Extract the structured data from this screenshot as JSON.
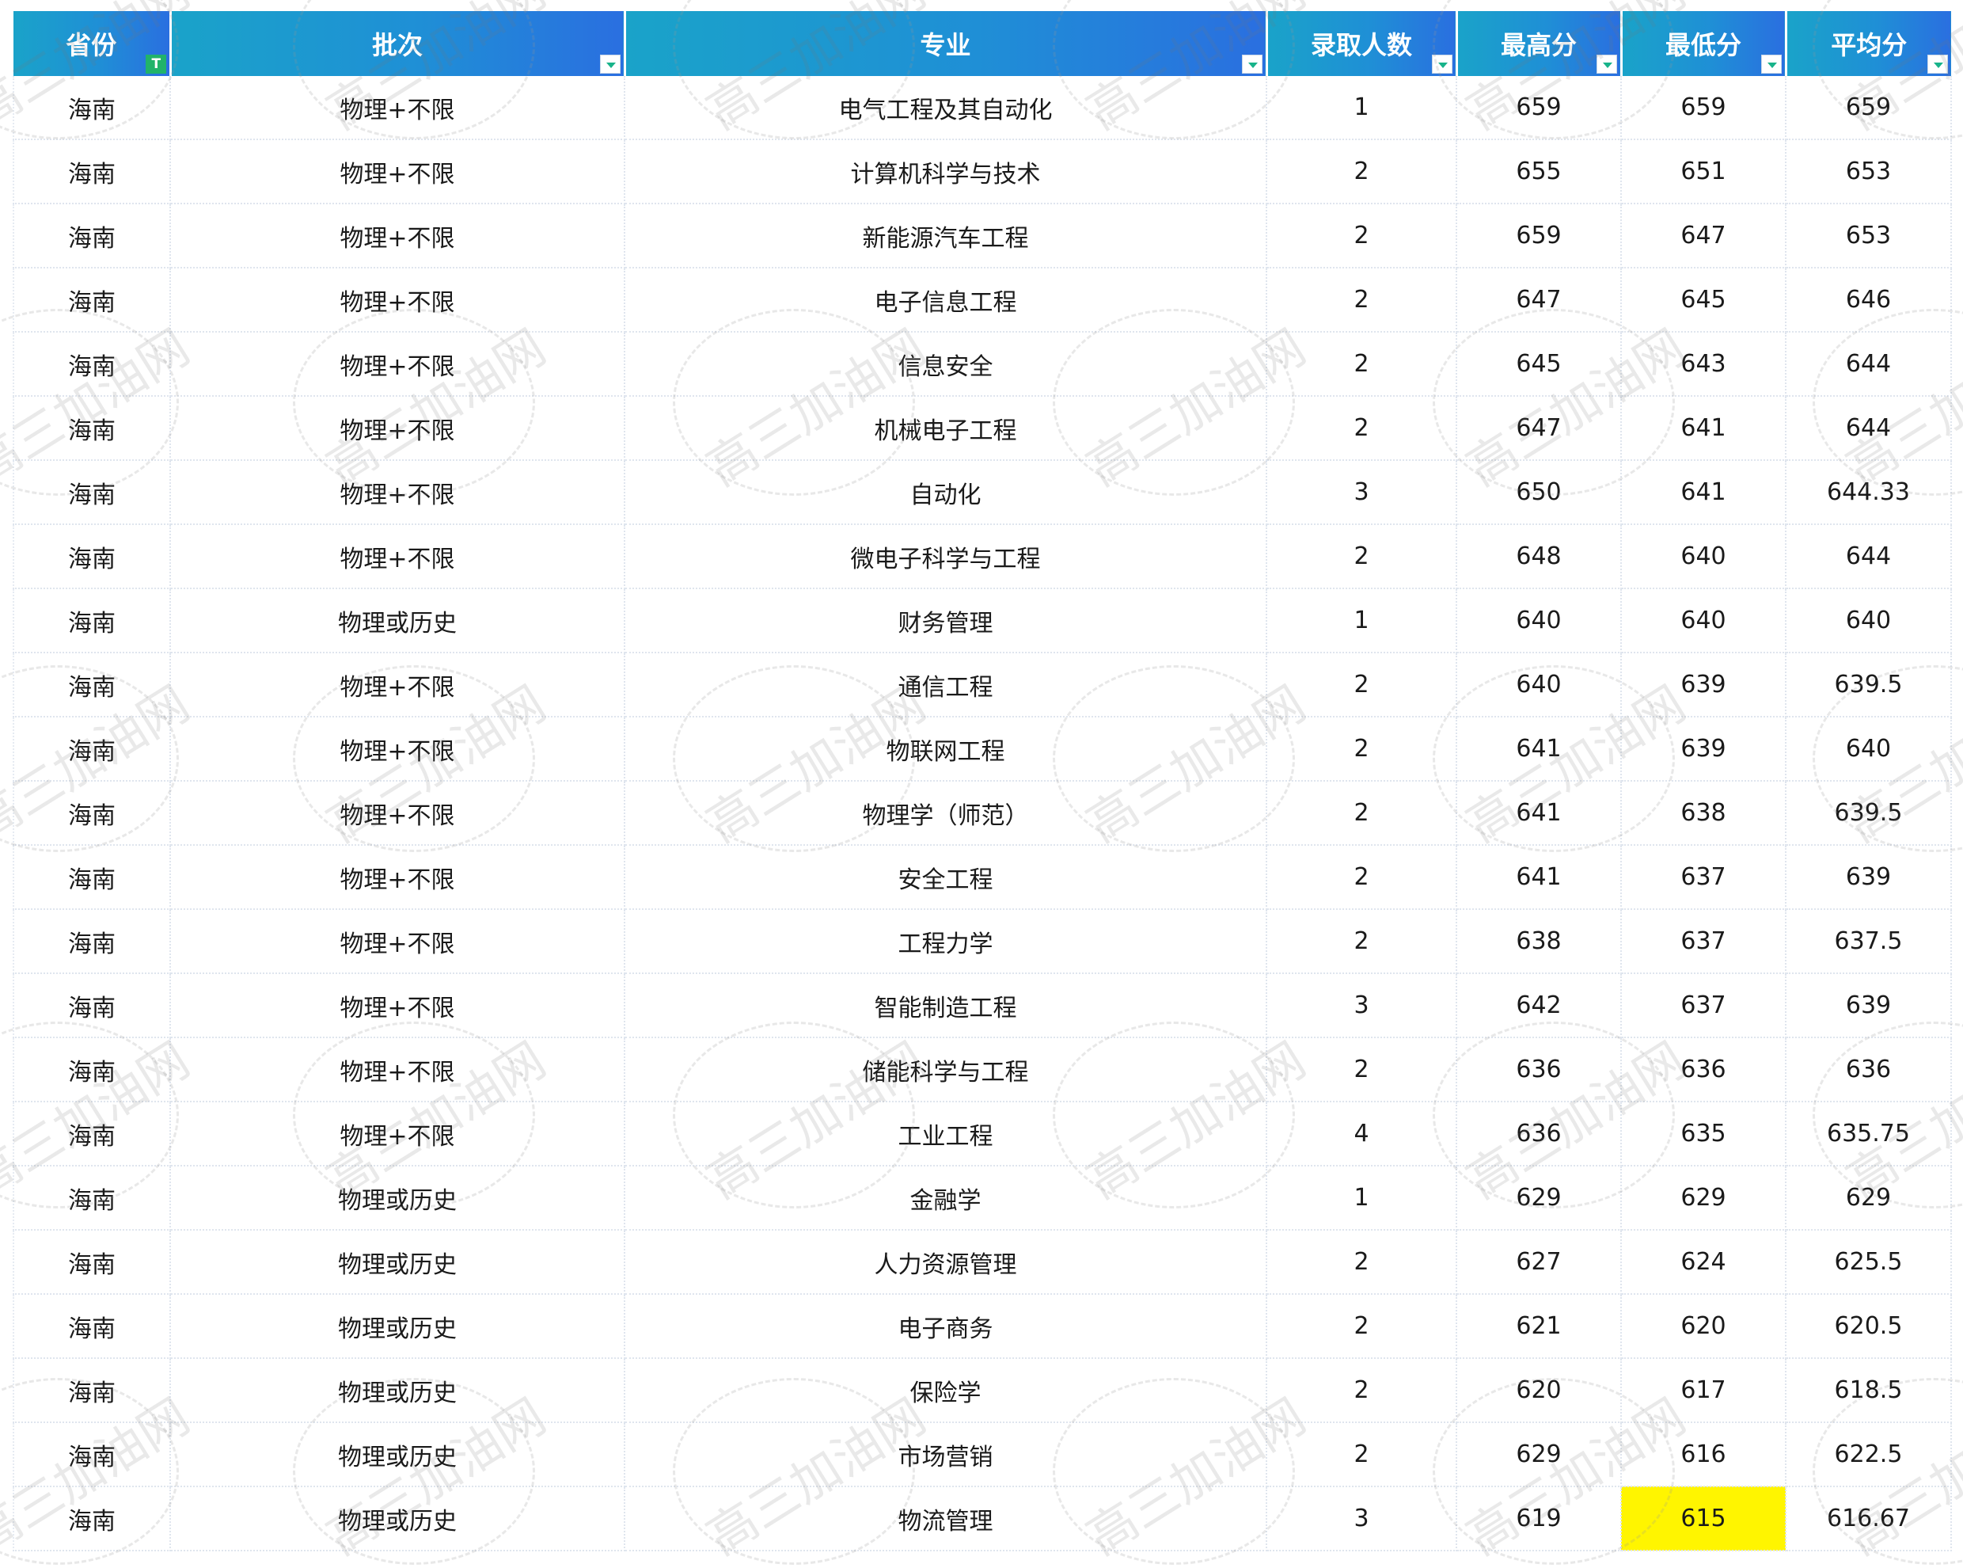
{
  "watermark_text": "高三加油网",
  "columns": [
    "省份",
    "批次",
    "专业",
    "录取人数",
    "最高分",
    "最低分",
    "平均分"
  ],
  "rows": [
    [
      "海南",
      "物理+不限",
      "电气工程及其自动化",
      "1",
      "659",
      "659",
      "659"
    ],
    [
      "海南",
      "物理+不限",
      "计算机科学与技术",
      "2",
      "655",
      "651",
      "653"
    ],
    [
      "海南",
      "物理+不限",
      "新能源汽车工程",
      "2",
      "659",
      "647",
      "653"
    ],
    [
      "海南",
      "物理+不限",
      "电子信息工程",
      "2",
      "647",
      "645",
      "646"
    ],
    [
      "海南",
      "物理+不限",
      "信息安全",
      "2",
      "645",
      "643",
      "644"
    ],
    [
      "海南",
      "物理+不限",
      "机械电子工程",
      "2",
      "647",
      "641",
      "644"
    ],
    [
      "海南",
      "物理+不限",
      "自动化",
      "3",
      "650",
      "641",
      "644.33"
    ],
    [
      "海南",
      "物理+不限",
      "微电子科学与工程",
      "2",
      "648",
      "640",
      "644"
    ],
    [
      "海南",
      "物理或历史",
      "财务管理",
      "1",
      "640",
      "640",
      "640"
    ],
    [
      "海南",
      "物理+不限",
      "通信工程",
      "2",
      "640",
      "639",
      "639.5"
    ],
    [
      "海南",
      "物理+不限",
      "物联网工程",
      "2",
      "641",
      "639",
      "640"
    ],
    [
      "海南",
      "物理+不限",
      "物理学（师范）",
      "2",
      "641",
      "638",
      "639.5"
    ],
    [
      "海南",
      "物理+不限",
      "安全工程",
      "2",
      "641",
      "637",
      "639"
    ],
    [
      "海南",
      "物理+不限",
      "工程力学",
      "2",
      "638",
      "637",
      "637.5"
    ],
    [
      "海南",
      "物理+不限",
      "智能制造工程",
      "3",
      "642",
      "637",
      "639"
    ],
    [
      "海南",
      "物理+不限",
      "储能科学与工程",
      "2",
      "636",
      "636",
      "636"
    ],
    [
      "海南",
      "物理+不限",
      "工业工程",
      "4",
      "636",
      "635",
      "635.75"
    ],
    [
      "海南",
      "物理或历史",
      "金融学",
      "1",
      "629",
      "629",
      "629"
    ],
    [
      "海南",
      "物理或历史",
      "人力资源管理",
      "2",
      "627",
      "624",
      "625.5"
    ],
    [
      "海南",
      "物理或历史",
      "电子商务",
      "2",
      "621",
      "620",
      "620.5"
    ],
    [
      "海南",
      "物理或历史",
      "保险学",
      "2",
      "620",
      "617",
      "618.5"
    ],
    [
      "海南",
      "物理或历史",
      "市场营销",
      "2",
      "629",
      "616",
      "622.5"
    ],
    [
      "海南",
      "物理或历史",
      "物流管理",
      "3",
      "619",
      "615",
      "616.67"
    ]
  ],
  "highlight": {
    "row": 22,
    "col": 5,
    "color": "#fff500"
  },
  "colors": {
    "header_start": "#1aa3c9",
    "header_end": "#2a6fe0",
    "filter_active": "#21b36a",
    "filter_arrow": "#18b38a"
  }
}
